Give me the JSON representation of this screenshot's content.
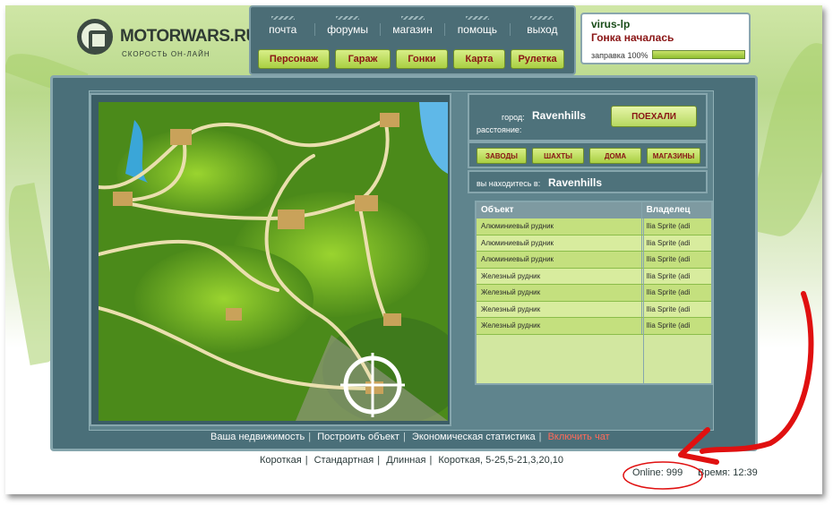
{
  "logo": {
    "name": "MOTORWARS.RU",
    "subtitle": "СКОРОСТЬ ОН-ЛАЙН"
  },
  "nav": {
    "top_links": [
      "почта",
      "форумы",
      "магазин",
      "помощь",
      "выход"
    ],
    "buttons": [
      "Персонаж",
      "Гараж",
      "Гонки",
      "Карта",
      "Рулетка"
    ]
  },
  "user": {
    "name": "virus-lp",
    "status": "Гонка началась",
    "fuel_label": "заправка 100%",
    "fuel_percent": 100
  },
  "city": {
    "city_label": "город:",
    "city_value": "Ravenhills",
    "distance_label": "расстояние:",
    "go_button": "ПОЕХАЛИ"
  },
  "categories": [
    "ЗАВОДЫ",
    "ШАХТЫ",
    "ДОМА",
    "МАГАЗИНЫ"
  ],
  "location": {
    "label": "вы находитесь в:",
    "value": "Ravenhills"
  },
  "table": {
    "headers": [
      "Объект",
      "Владелец"
    ],
    "rows": [
      {
        "object": "Алюминиевый рудник",
        "owner": "Ilia Sprite (adi"
      },
      {
        "object": "Алюминиевый рудник",
        "owner": "Ilia Sprite (adi"
      },
      {
        "object": "Алюминиевый рудник",
        "owner": "Ilia Sprite (adi"
      },
      {
        "object": "Железный рудник",
        "owner": "Ilia Sprite (adi"
      },
      {
        "object": "Железный рудник",
        "owner": "Ilia Sprite (adi"
      },
      {
        "object": "Железный рудник",
        "owner": "Ilia Sprite (adi"
      },
      {
        "object": "Железный рудник",
        "owner": "Ilia Sprite (adi"
      }
    ]
  },
  "footer_links": [
    "Ваша недвижимость",
    "Построить объект",
    "Экономическая статистика",
    "Включить чат"
  ],
  "footer_modes": [
    "Короткая",
    "Стандартная",
    "Длинная",
    "Короткая, 5-25,5-21,3,20,10"
  ],
  "status": {
    "online": "Online: 999",
    "time": "Время: 12:39"
  },
  "colors": {
    "accent_red": "#8a1515",
    "panel": "#4a6f79",
    "button_green": "#a9cf42",
    "annotation_red": "#e01010"
  }
}
